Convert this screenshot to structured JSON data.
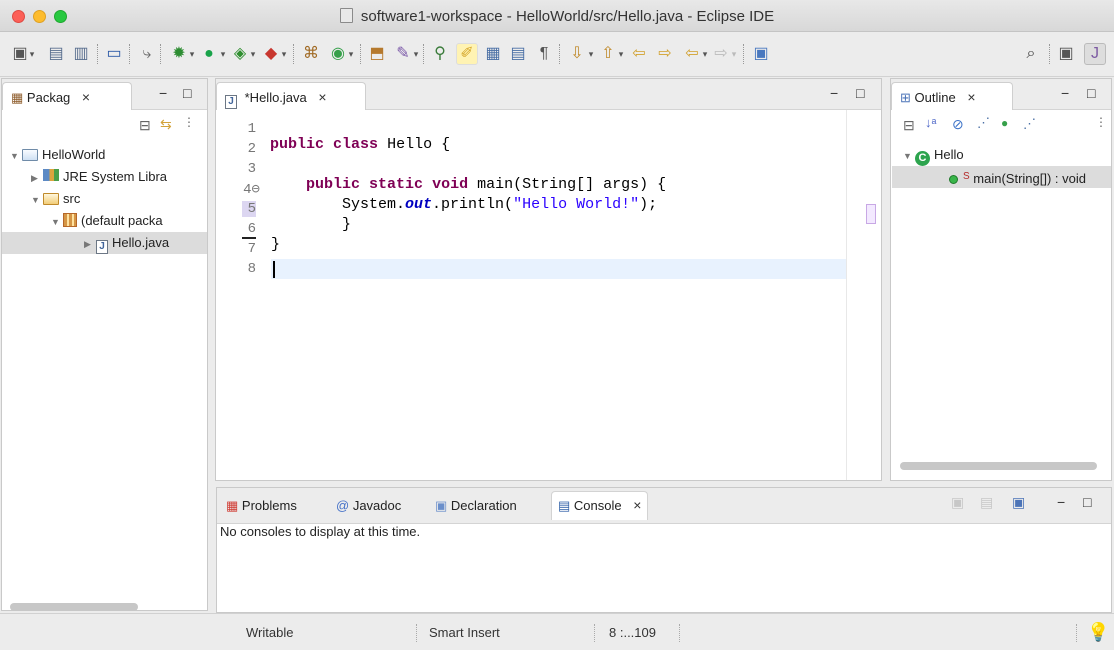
{
  "window": {
    "title": "software1-workspace - HelloWorld/src/Hello.java - Eclipse IDE"
  },
  "toolbar": {
    "icons": [
      "new-icon",
      "save-icon",
      "save-all-icon",
      "terminal-icon",
      "skip-breakpoints-icon",
      "debug-icon",
      "run-icon",
      "coverage-icon",
      "external-tools-icon",
      "new-java-project-icon",
      "new-class-icon",
      "open-type-icon",
      "search-icon",
      "perspective-icon"
    ]
  },
  "package_explorer": {
    "tab_label": "Packag",
    "tree": [
      {
        "label": "HelloWorld",
        "icon": "project-folder-icon"
      },
      {
        "label": "JRE System Libra",
        "icon": "library-icon"
      },
      {
        "label": "src",
        "icon": "source-folder-icon"
      },
      {
        "label": "(default packa",
        "icon": "package-icon"
      },
      {
        "label": "Hello.java",
        "icon": "java-file-icon"
      }
    ]
  },
  "editor": {
    "tab_label": "*Hello.java",
    "line_numbers": [
      "1",
      "2",
      "3",
      "4⊖",
      "5",
      "6",
      "7",
      "8"
    ],
    "lines": [
      "",
      "public class Hello {",
      "",
      "    public static void main(String[] args) {",
      "        System.out.println(\"Hello World!\");",
      "        }",
      "}",
      ""
    ],
    "tokens": {
      "public": "public",
      "class": "class",
      "static": "static",
      "void": "void",
      "hello_class": "Hello {",
      "main_sig": "main(String[] args) {",
      "system": "System.",
      "out": "out",
      "println": ".println(",
      "hello_string": "\"Hello World!\"",
      "end_statement": ");",
      "close_brace_inner": "}",
      "close_brace_outer": "}"
    }
  },
  "outline": {
    "tab_label": "Outline",
    "class_name": "Hello",
    "method_name": "main(String[]) : void"
  },
  "bottom_panel": {
    "tabs": [
      "Problems",
      "Javadoc",
      "Declaration",
      "Console"
    ],
    "console_message": "No consoles to display at this time."
  },
  "status_bar": {
    "mode": "Writable",
    "insert_mode": "Smart Insert",
    "position": "8 :...109"
  }
}
